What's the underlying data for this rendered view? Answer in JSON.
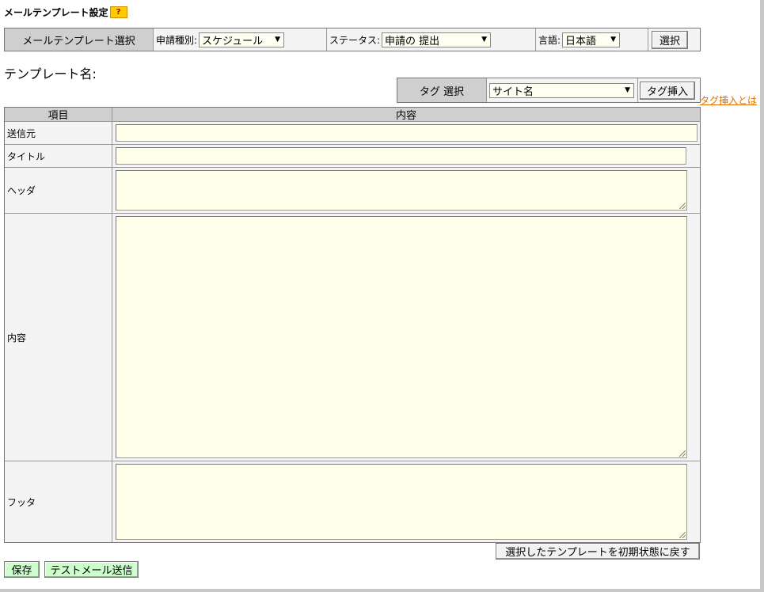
{
  "page": {
    "title": "メールテンプレート設定",
    "help_badge": "?"
  },
  "selector_bar": {
    "section_label": "メールテンプレート選択",
    "request_type_label": "申請種別:",
    "request_type_value": "スケジュール",
    "status_label": "ステータス:",
    "status_value": "申請の 提出",
    "language_label": "言語:",
    "language_value": "日本語",
    "select_button": "選択"
  },
  "template_name_label": "テンプレート名:",
  "tag_bar": {
    "label": "タグ 選択",
    "tag_value": "サイト名",
    "insert_button": "タグ挿入",
    "help_link": "タグ挿入とは"
  },
  "form": {
    "headers": {
      "item": "項目",
      "content": "内容"
    },
    "rows": {
      "sender": "送信元",
      "title": "タイトル",
      "header": "ヘッダ",
      "body": "内容",
      "footer": "フッタ"
    }
  },
  "buttons": {
    "reset": "選択したテンプレートを初期状態に戻す",
    "save": "保存",
    "test_send": "テストメール送信"
  },
  "colors": {
    "input_bg": "#ffffea",
    "header_bg": "#cfcfcf",
    "green_button": "#ccffcc",
    "link_orange": "#e07000",
    "help_badge": "#ffcc00"
  }
}
